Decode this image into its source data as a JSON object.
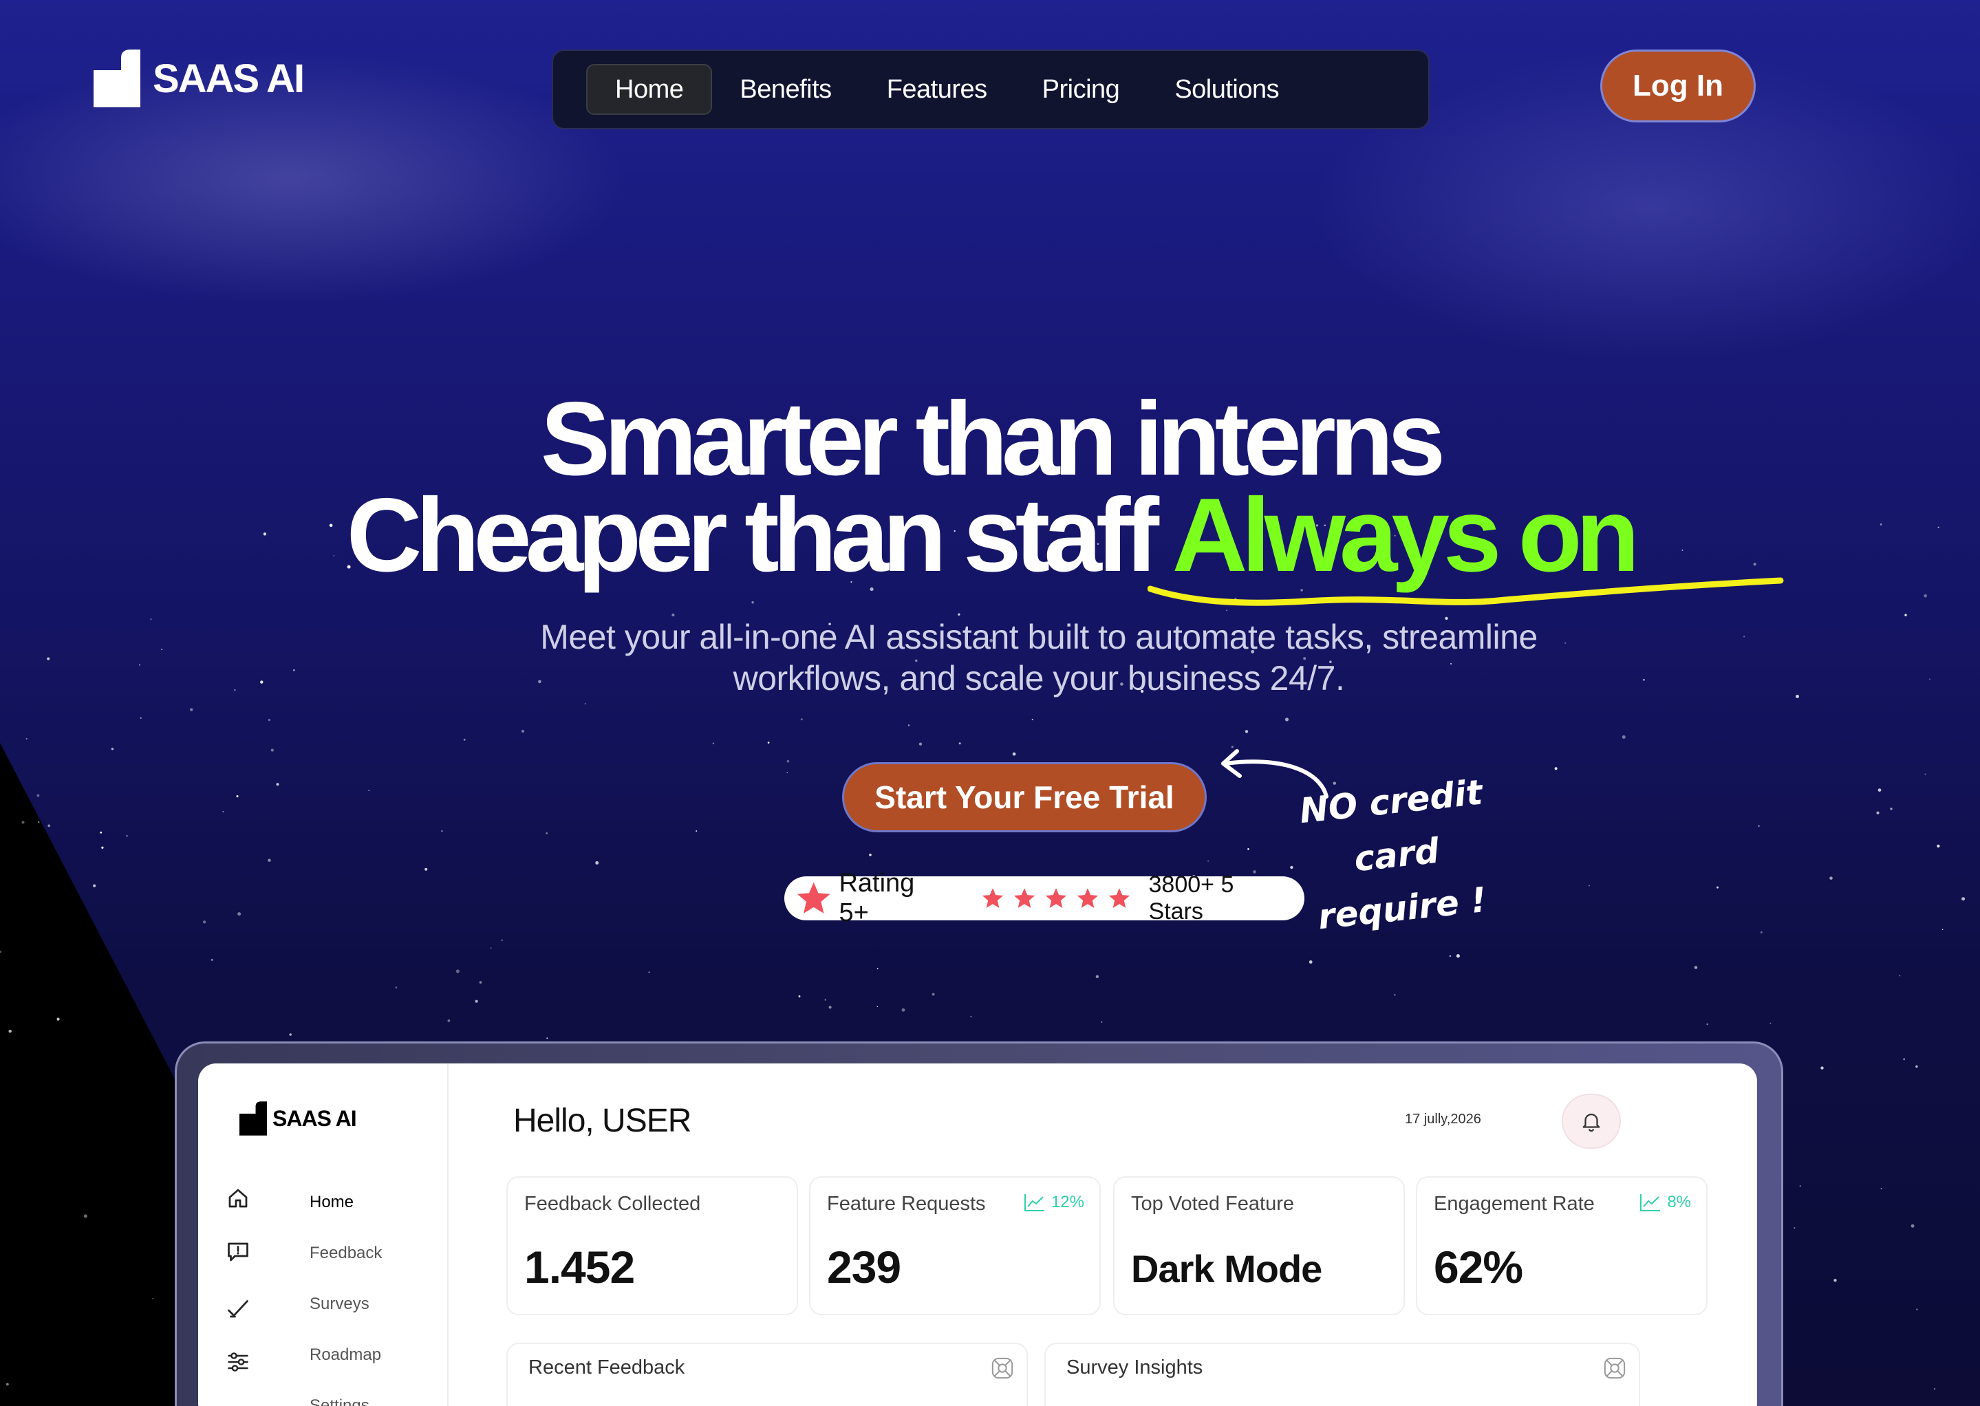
{
  "brand": {
    "name": "SAAS AI"
  },
  "nav": {
    "items": [
      {
        "label": "Home",
        "active": true
      },
      {
        "label": "Benefits",
        "active": false
      },
      {
        "label": "Features",
        "active": false
      },
      {
        "label": "Pricing",
        "active": false
      },
      {
        "label": "Solutions",
        "active": false
      }
    ],
    "login_label": "Log In"
  },
  "hero": {
    "line1": "Smarter than interns",
    "line2_white": "Cheaper than staff",
    "line2_green": "Always on",
    "subtitle_line1": "Meet your all-in-one AI assistant built to automate tasks, streamline",
    "subtitle_line2": "workflows, and scale your business 24/7.",
    "cta_label": "Start Your Free Trial",
    "note_line1": "NO credit card",
    "note_line2": "require !",
    "rating_label": "Rating 5+",
    "rating_stars": 5,
    "rating_count": "3800+ 5 Stars"
  },
  "colors": {
    "accent_orange": "#b14e26",
    "accent_green": "#7dff1e",
    "underline_yellow": "#f3f01a",
    "star_red": "#f0515c",
    "trend_teal": "#2fd1a8"
  },
  "dashboard": {
    "brand": "SAAS AI",
    "greeting": "Hello, USER",
    "date": "17 jully,2026",
    "sidebar": [
      {
        "label": "Home",
        "icon": "home-icon",
        "active": true
      },
      {
        "label": "Feedback",
        "icon": "feedback-icon",
        "active": false
      },
      {
        "label": "Surveys",
        "icon": "surveys-icon",
        "active": false
      },
      {
        "label": "Roadmap",
        "icon": "roadmap-icon",
        "active": false
      },
      {
        "label": "Settings",
        "icon": "settings-icon",
        "active": false
      }
    ],
    "cards": [
      {
        "title": "Feedback Collected",
        "value": "1.452",
        "trend": ""
      },
      {
        "title": "Feature Requests",
        "value": "239",
        "trend": "12%"
      },
      {
        "title": "Top Voted Feature",
        "value": "Dark Mode",
        "trend": ""
      },
      {
        "title": "Engagement Rate",
        "value": "62%",
        "trend": "8%"
      }
    ],
    "panels": [
      {
        "title": "Recent Feedback"
      },
      {
        "title": "Survey Insights"
      }
    ]
  }
}
